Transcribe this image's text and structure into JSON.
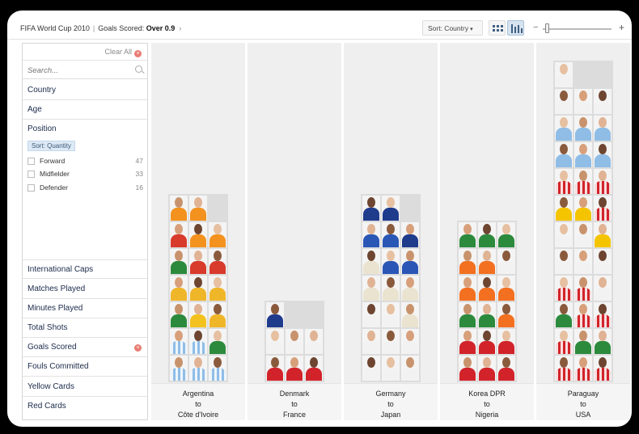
{
  "breadcrumb": {
    "title": "FIFA World Cup 2010",
    "filter_label": "Goals Scored:",
    "filter_value": "Over 0.9",
    "chevron": "›"
  },
  "toolbar": {
    "sort_label": "Sort: Country",
    "sort_arrow": "▾",
    "zoom_minus": "−",
    "zoom_plus": "+",
    "zoom_level": 0.05,
    "view_modes": [
      "grid-view-icon",
      "bar-view-icon"
    ],
    "active_view": "bar-view-icon"
  },
  "sidebar": {
    "clear_all": "Clear All",
    "clear_icon": "×",
    "search_placeholder": "Search...",
    "facets_top": [
      "Country",
      "Age",
      "Position"
    ],
    "sort_badge": "Sort: Quantity",
    "position_options": [
      {
        "label": "Forward",
        "count": "47"
      },
      {
        "label": "Midfielder",
        "count": "33"
      },
      {
        "label": "Defender",
        "count": "16"
      }
    ],
    "facets_bottom": [
      "International Caps",
      "Matches Played",
      "Minutes Played",
      "Total Shots",
      "Goals Scored",
      "Fouls Committed",
      "Yellow Cards",
      "Red Cards"
    ],
    "active_filter": "Goals Scored"
  },
  "columns": [
    {
      "from": "Argentina",
      "to_word": "to",
      "to": "Côte d'Ivoire",
      "count": 20,
      "jerseys": [
        "#8fbde6",
        "#8fbde6",
        "#8fbde6",
        "#8fbde6",
        "#8fbde6",
        "#2c8a3c",
        "#2c8a3c",
        "#f4c21e",
        "#f0b62a",
        "#f0b62a",
        "#f0b62a",
        "#f0b62a",
        "#2c8a3c",
        "#d83a2c",
        "#d83a2c",
        "#d83a2c",
        "#f3921f",
        "#f3921f",
        "#f3921f",
        "#f3921f"
      ],
      "striped": [
        0,
        1,
        2,
        3,
        4
      ]
    },
    {
      "from": "Denmark",
      "to_word": "to",
      "to": "France",
      "count": 7,
      "jerseys": [
        "#d2232a",
        "#d2232a",
        "#d2232a",
        "#f2f2f2",
        "#f2f2f2",
        "#f2f2f2",
        "#1f3b8c"
      ],
      "striped": []
    },
    {
      "from": "Germany",
      "to_word": "to",
      "to": "Japan",
      "count": 20,
      "jerseys": [
        "#f2f2f2",
        "#f2f2f2",
        "#f2f2f2",
        "#f2f2f2",
        "#f2f2f2",
        "#f2f2f2",
        "#f2f2f2",
        "#f2f2f2",
        "#eae3cf",
        "#eae3cf",
        "#eae3cf",
        "#eae3cf",
        "#eae3cf",
        "#2a57b6",
        "#2a57b6",
        "#2a57b6",
        "#2a57b6",
        "#1f3b8c",
        "#1f3b8c",
        "#1f3b8c"
      ],
      "striped": []
    },
    {
      "from": "Korea DPR",
      "to_word": "to",
      "to": "Nigeria",
      "count": 18,
      "jerseys": [
        "#d2232a",
        "#d2232a",
        "#d2232a",
        "#d2232a",
        "#d2232a",
        "#d2232a",
        "#2c8a3c",
        "#2c8a3c",
        "#f37021",
        "#f37021",
        "#f37021",
        "#f37021",
        "#f37021",
        "#f37021",
        "#f2f2f2",
        "#2c8a3c",
        "#2c8a3c",
        "#2c8a3c"
      ],
      "striped": []
    },
    {
      "from": "Paraguay",
      "to_word": "to",
      "to": "USA",
      "count": 34,
      "jerseys": [
        "#d2232a",
        "#d2232a",
        "#d2232a",
        "#d2232a",
        "#2c8a3c",
        "#2c8a3c",
        "#2c8a3c",
        "#d2232a",
        "#d2232a",
        "#d2232a",
        "#d2232a",
        "#f2f2f2",
        "#f2f2f2",
        "#f2f2f2",
        "#f2f2f2",
        "#f2f2f2",
        "#f2f2f2",
        "#f5c400",
        "#f5c400",
        "#f5c400",
        "#d2232a",
        "#d2232a",
        "#d2232a",
        "#d2232a",
        "#8fbde6",
        "#8fbde6",
        "#8fbde6",
        "#8fbde6",
        "#8fbde6",
        "#8fbde6",
        "#f2f2f2",
        "#f2f2f2",
        "#f2f2f2",
        "#f2f2f2"
      ],
      "striped": [
        0,
        1,
        2,
        3,
        7,
        8,
        9,
        10,
        20,
        21,
        22,
        23
      ]
    }
  ]
}
